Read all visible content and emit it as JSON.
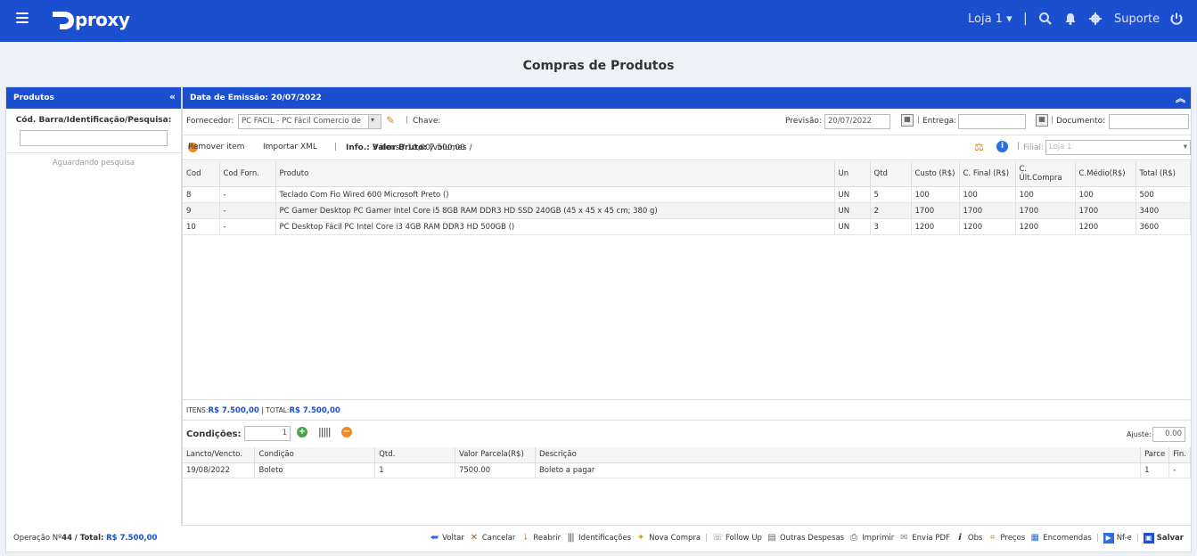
{
  "topbar": {
    "logo_text": "proxy",
    "store_label": "Loja 1",
    "support_label": "Suporte"
  },
  "page_title": "Compras de Produtos",
  "left_panel": {
    "title": "Produtos",
    "search_label": "Cód. Barra/Identificação/Pesquisa:",
    "search_value": "",
    "status_text": "Aguardando pesquisa"
  },
  "main_panel": {
    "header": "Data de Emissão: 20/07/2022",
    "fornecedor_label": "Fornecedor:",
    "fornecedor_value": "PC FACIL - PC Fácil Comercio de",
    "chave_label": "Chave:",
    "previsao_label": "Previsão:",
    "previsao_value": "20/07/2022",
    "entrega_label": "Entrega:",
    "documento_label": "Documento:",
    "remover_label": "Remover item",
    "importar_label": "Importar XML",
    "info_label": "Info.:",
    "info_text": "3 itens / 10,00 volumes /",
    "valor_bruto_label": "Valor Bruto:",
    "valor_bruto_value": "7.500,00",
    "filial_label": "Filial:",
    "filial_value": "Loja 1"
  },
  "items_table": {
    "columns": [
      "Cod",
      "Cod Forn.",
      "Produto",
      "Un",
      "Qtd",
      "Custo (R$)",
      "C. Final (R$)",
      "C. Últ.Compra",
      "C.Médio(R$)",
      "Total (R$)"
    ],
    "rows": [
      [
        "8",
        "-",
        "Teclado Com Fio Wired 600 Microsoft Preto ()",
        "UN",
        "5",
        "100",
        "100",
        "100",
        "100",
        "500"
      ],
      [
        "9",
        "-",
        "PC Gamer Desktop PC Gamer Intel Core i5 8GB RAM DDR3 HD SSD 240GB (45 x 45 x 45 cm; 380 g)",
        "UN",
        "2",
        "1700",
        "1700",
        "1700",
        "1700",
        "3400"
      ],
      [
        "10",
        "-",
        "PC Desktop Fácil PC Intel Core i3 4GB RAM DDR3 HD 500GB ()",
        "UN",
        "3",
        "1200",
        "1200",
        "1200",
        "1200",
        "3600"
      ]
    ]
  },
  "totals": {
    "itens_label": "ITENS:",
    "itens_value": "R$ 7.500,00",
    "total_label": "| TOTAL:",
    "total_value": "R$ 7.500,00"
  },
  "conditions": {
    "label": "Condições:",
    "count_value": "1",
    "ajuste_label": "Ajuste:",
    "ajuste_value": "0.00",
    "columns": [
      "Lancto/Vencto.",
      "Condição",
      "Qtd.",
      "Valor Parcela(R$)",
      "Descrição",
      "Parce",
      "Fin."
    ],
    "rows": [
      [
        "19/08/2022",
        "Boleto",
        "1",
        "7500.00",
        "Boleto a pagar",
        "1",
        "-"
      ]
    ]
  },
  "footer": {
    "operacao_label": "Operação Nº",
    "operacao_value": "44",
    "total_label": "/ Total:",
    "total_value": "R$ 7.500,00",
    "actions": [
      "Voltar",
      "Cancelar",
      "Reabrir",
      "Identificações",
      "Nova Compra",
      "Follow Up",
      "Outras Despesas",
      "Imprimir",
      "Envia PDF",
      "Obs",
      "Preços",
      "Encomendas",
      "Nf-e",
      "Salvar"
    ]
  },
  "colors": {
    "primary": "#1b4fd0",
    "background": "#eef2f7"
  }
}
